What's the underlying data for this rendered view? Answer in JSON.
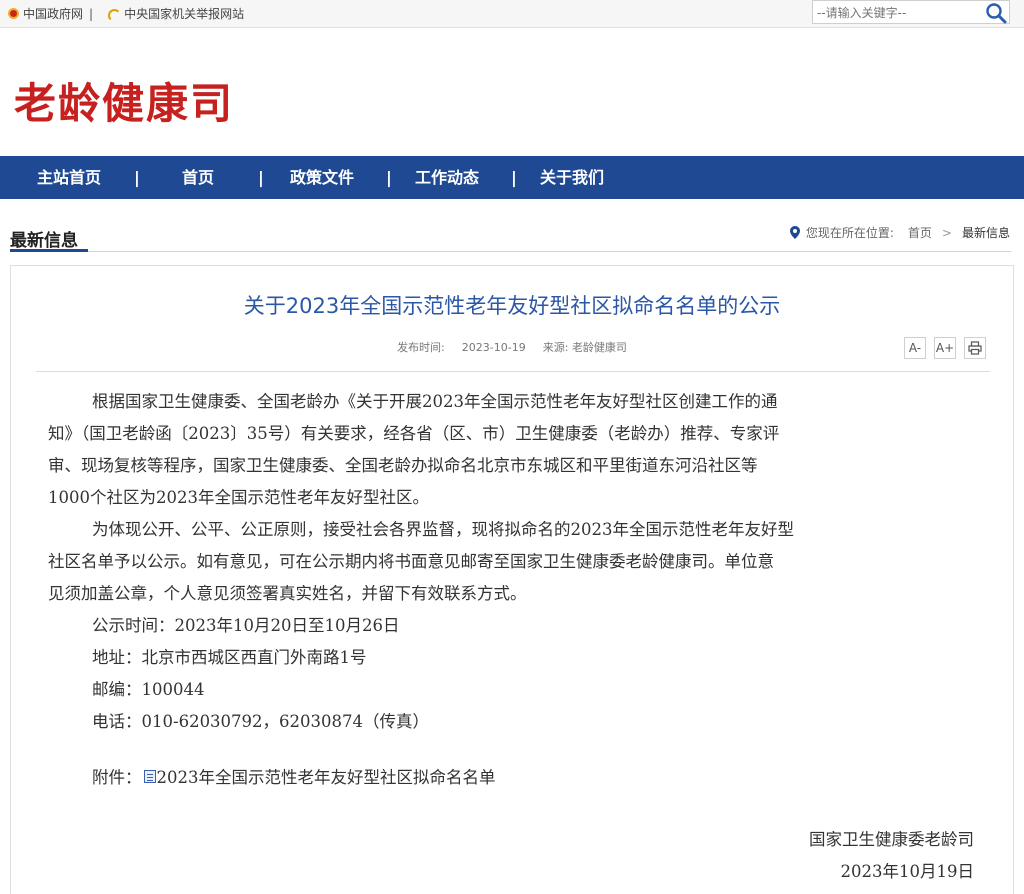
{
  "topbar": {
    "link_gov": "中国政府网",
    "separator": "|",
    "link_report": "中央国家机关举报网站",
    "search_placeholder": "--请输入关键字--"
  },
  "header": {
    "title": "老龄健康司"
  },
  "nav": {
    "items": [
      "主站首页",
      "首页",
      "政策文件",
      "工作动态",
      "关于我们"
    ],
    "separator": "|"
  },
  "section": {
    "title": "最新信息",
    "location_label": "您现在所在位置:",
    "crumb_home": "首页",
    "crumb_sep": ">",
    "crumb_current": "最新信息"
  },
  "article": {
    "title": "关于2023年全国示范性老年友好型社区拟命名名单的公示",
    "publish_label": "发布时间:",
    "publish_date": "2023-10-19",
    "source_label": "来源:",
    "source": "老龄健康司",
    "tools": {
      "font_smaller": "A-",
      "font_larger": "A+"
    },
    "lines": [
      "根据国家卫生健康委、全国老龄办《关于开展2023年全国示范性老年友好型社区创建工作的通",
      "知》（国卫老龄函〔2023〕35号）有关要求，经各省（区、市）卫生健康委（老龄办）推荐、专家评",
      "审、现场复核等程序，国家卫生健康委、全国老龄办拟命名北京市东城区和平里街道东河沿社区等",
      "1000个社区为2023年全国示范性老年友好型社区。",
      "为体现公开、公平、公正原则，接受社会各界监督，现将拟命名的2023年全国示范性老年友好型",
      "社区名单予以公示。如有意见，可在公示期内将书面意见邮寄至国家卫生健康委老龄健康司。单位意",
      "见须加盖公章，个人意见须签署真实姓名，并留下有效联系方式。",
      "公示时间：2023年10月20日至10月26日",
      "地址：北京市西城区西直门外南路1号",
      "邮编：100044",
      "电话：010-62030792，62030874（传真）"
    ],
    "attachment_label": "附件：",
    "attachment_name": "2023年全国示范性老年友好型社区拟命名名单",
    "sign_org": "国家卫生健康委老龄司",
    "sign_date": "2023年10月19日"
  },
  "colors": {
    "brand_red": "#c6201f",
    "nav_blue": "#1f4a93",
    "title_blue": "#2b57a6"
  }
}
